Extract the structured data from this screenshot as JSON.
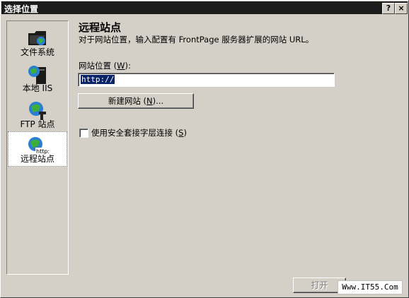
{
  "window": {
    "title": "选择位置",
    "help_label": "?",
    "close_label": "×"
  },
  "sidebar": {
    "items": [
      {
        "label": "文件系统",
        "icon": "folder-globe-icon"
      },
      {
        "label": "本地 IIS",
        "icon": "local-server-icon"
      },
      {
        "label": "FTP 站点",
        "icon": "ftp-globe-icon"
      },
      {
        "label": "远程站点",
        "icon": "http-globe-icon",
        "selected": true
      }
    ]
  },
  "main": {
    "heading": "远程站点",
    "description": "对于网站位置，输入配置有 FrontPage 服务器扩展的网站 URL。",
    "url_label_pre": "网站位置 (",
    "url_label_key": "W",
    "url_label_post": "):",
    "url_value": "http://",
    "new_site_pre": "新建网站 (",
    "new_site_key": "N",
    "new_site_post": ")...",
    "ssl_pre": "使用安全套接字层连接 (",
    "ssl_key": "S",
    "ssl_post": ")",
    "ssl_checked": false
  },
  "footer": {
    "open_label": "打开",
    "watermark": "Www.IT55.Com"
  },
  "colors": {
    "titlebar": "#1c1c1c",
    "face": "#d4d0c8",
    "selection": "#0a246a"
  }
}
